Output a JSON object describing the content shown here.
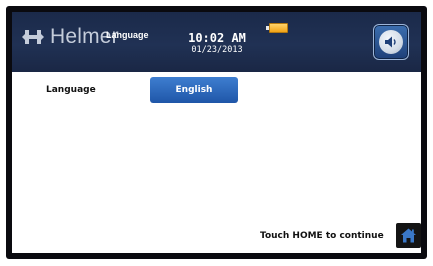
{
  "header": {
    "brand_name": "Helmer",
    "screen_title": "Language",
    "time": "10:02 AM",
    "date": "01/23/2013",
    "battery_icon": "battery-icon",
    "sound_icon": "speaker-icon"
  },
  "main": {
    "language_label": "Language",
    "language_value": "English"
  },
  "footer": {
    "continue_text": "Touch HOME to continue",
    "home_icon": "home-icon"
  },
  "colors": {
    "header_bg": "#203154",
    "button_blue": "#2f6cc0",
    "bezel": "#0a0a0f"
  }
}
